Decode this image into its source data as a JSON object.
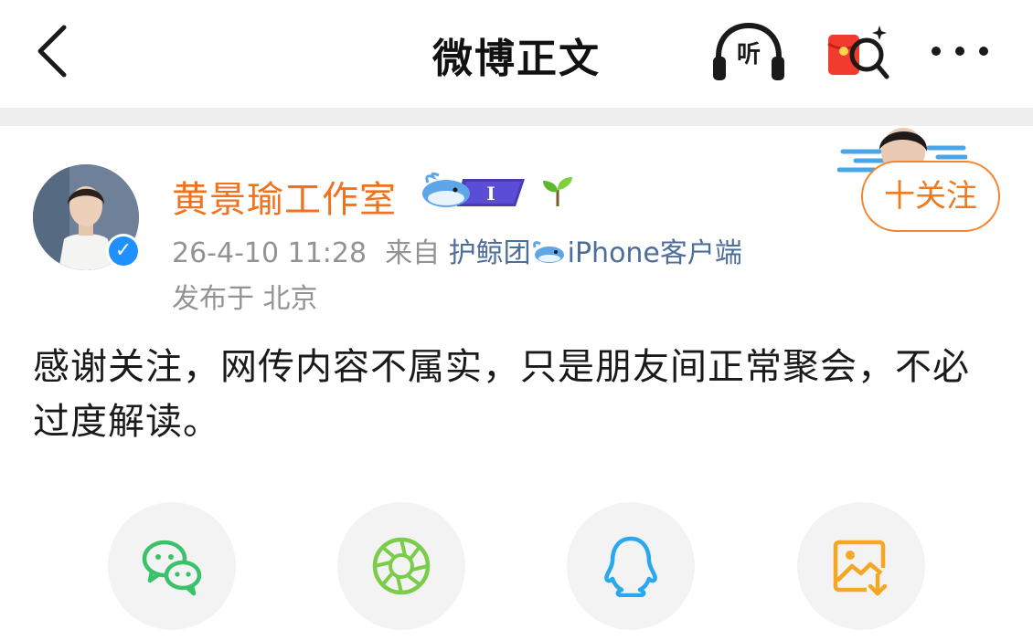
{
  "header": {
    "title": "微博正文",
    "listen_label": "听"
  },
  "post": {
    "author": "黄景瑜工作室",
    "verified_mark": "✓",
    "badge_text": "I",
    "time": "26-4-10 11:28",
    "source_prefix": "来自",
    "source_name_1": "护鲸团",
    "source_name_2": "iPhone客户端",
    "location": "发布于 北京",
    "follow_label": "十关注",
    "text": "感谢关注，网传内容不属实，只是朋友间正常聚会，不必过度解读。"
  },
  "share": [
    {
      "name": "wechat",
      "icon": "wechat-icon",
      "color": "#39c26a"
    },
    {
      "name": "moments",
      "icon": "wechat-moments-icon",
      "color": "#7bcc4a"
    },
    {
      "name": "qq",
      "icon": "qq-icon",
      "color": "#2aa8ee"
    },
    {
      "name": "save-image",
      "icon": "save-image-icon",
      "color": "#f5a623"
    }
  ],
  "colors": {
    "accent": "#f07a1e",
    "link": "#4e6e9a",
    "meta": "#939393"
  }
}
